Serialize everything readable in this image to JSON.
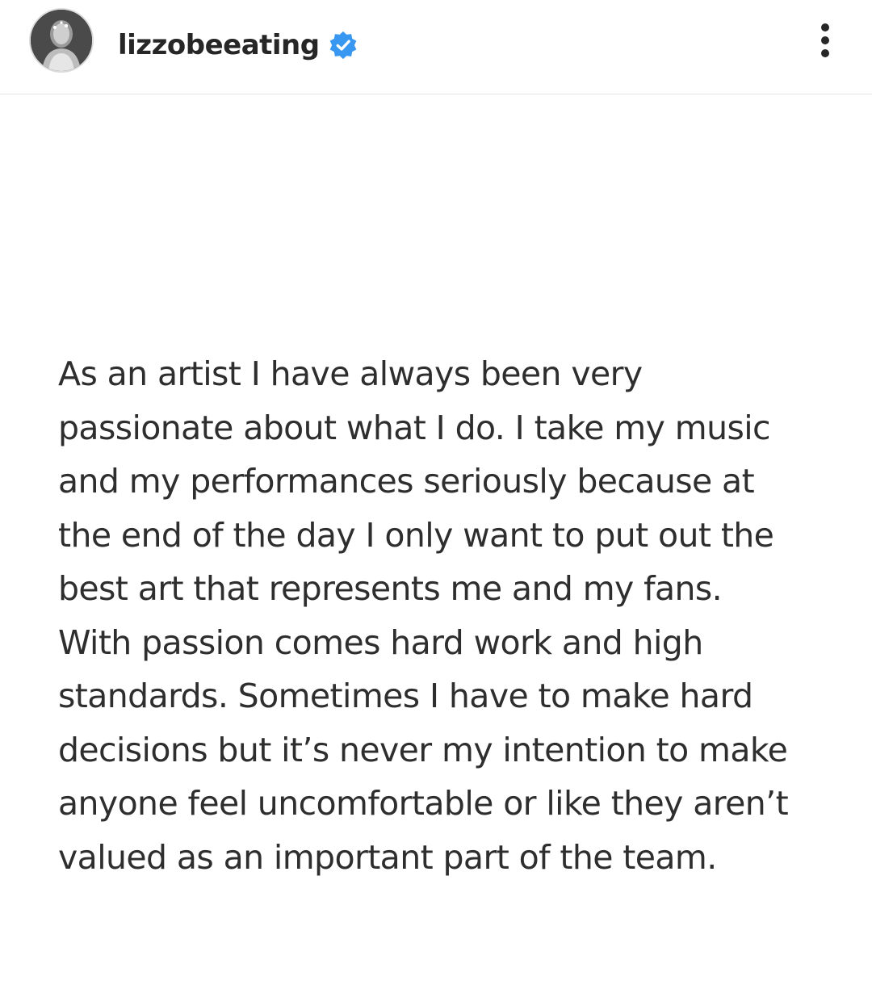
{
  "header": {
    "username": "lizzobeeating",
    "avatar_icon": "profile-photo",
    "verified_icon": "verified-badge-icon",
    "verified_color": "#3897f0",
    "more_icon": "more-vertical-icon"
  },
  "post": {
    "lines": [
      "As an artist I have always been very",
      "passionate about what I do. I take my music",
      "and my performances seriously because at",
      "the end of the day I only want to put out the",
      "best art that represents me and my fans.",
      "With passion comes hard work and high",
      "standards. Sometimes I have to make hard",
      "decisions but it’s never my intention to make",
      "anyone feel uncomfortable or like they aren’t",
      "valued as an important part of the team."
    ]
  }
}
